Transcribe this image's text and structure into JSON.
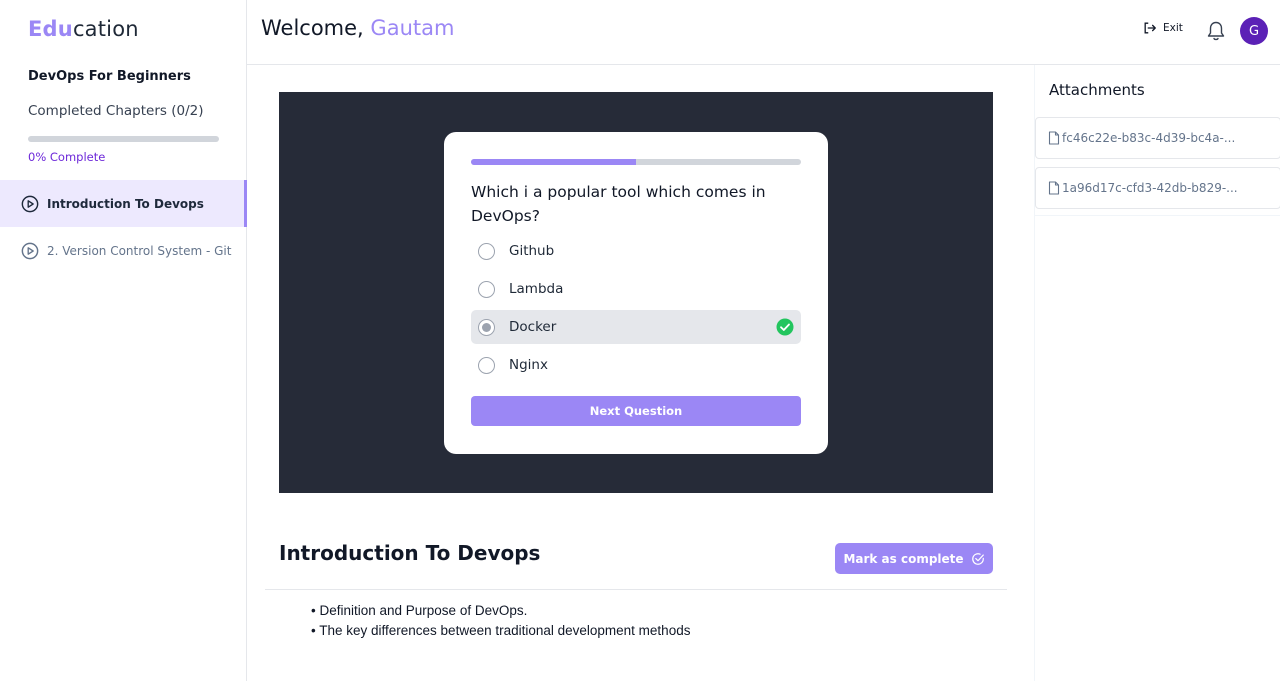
{
  "brand": {
    "accent": "Edu",
    "rest": "cation"
  },
  "course": {
    "title": "DevOps For Beginners",
    "completed_label": "Completed Chapters (0/2)",
    "progress_percent": 0,
    "progress_label": "0% Complete"
  },
  "chapters": [
    {
      "label": "Introduction To Devops",
      "active": true,
      "icon": "play-circle-icon"
    },
    {
      "label": "2. Version Control System - Git",
      "active": false,
      "icon": "play-circle-icon"
    }
  ],
  "header": {
    "welcome_prefix": "Welcome, ",
    "user_name": "Gautam",
    "exit_label": "Exit",
    "avatar_initial": "G"
  },
  "quiz": {
    "progress_fraction": 0.5,
    "question": "Which i a popular tool which comes in DevOps?",
    "options": [
      {
        "label": "Github",
        "selected": false,
        "correct": false
      },
      {
        "label": "Lambda",
        "selected": false,
        "correct": false
      },
      {
        "label": "Docker",
        "selected": true,
        "correct": true
      },
      {
        "label": "Nginx",
        "selected": false,
        "correct": false
      }
    ],
    "next_label": "Next Question"
  },
  "chapter_info": {
    "title": "Introduction To Devops",
    "mark_complete_label": "Mark as complete",
    "bullets": [
      "• Definition and Purpose of DevOps.",
      "• The key differences between traditional development methods"
    ]
  },
  "attachments": {
    "title": "Attachments",
    "files": [
      {
        "name": "fc46c22e-b83c-4d39-bc4a-..."
      },
      {
        "name": "1a96d17c-cfd3-42db-b829-..."
      }
    ]
  },
  "colors": {
    "accent": "#9b87f5",
    "player_bg": "#262b38",
    "correct": "#22c55e",
    "avatar_bg": "#5b21b6"
  }
}
